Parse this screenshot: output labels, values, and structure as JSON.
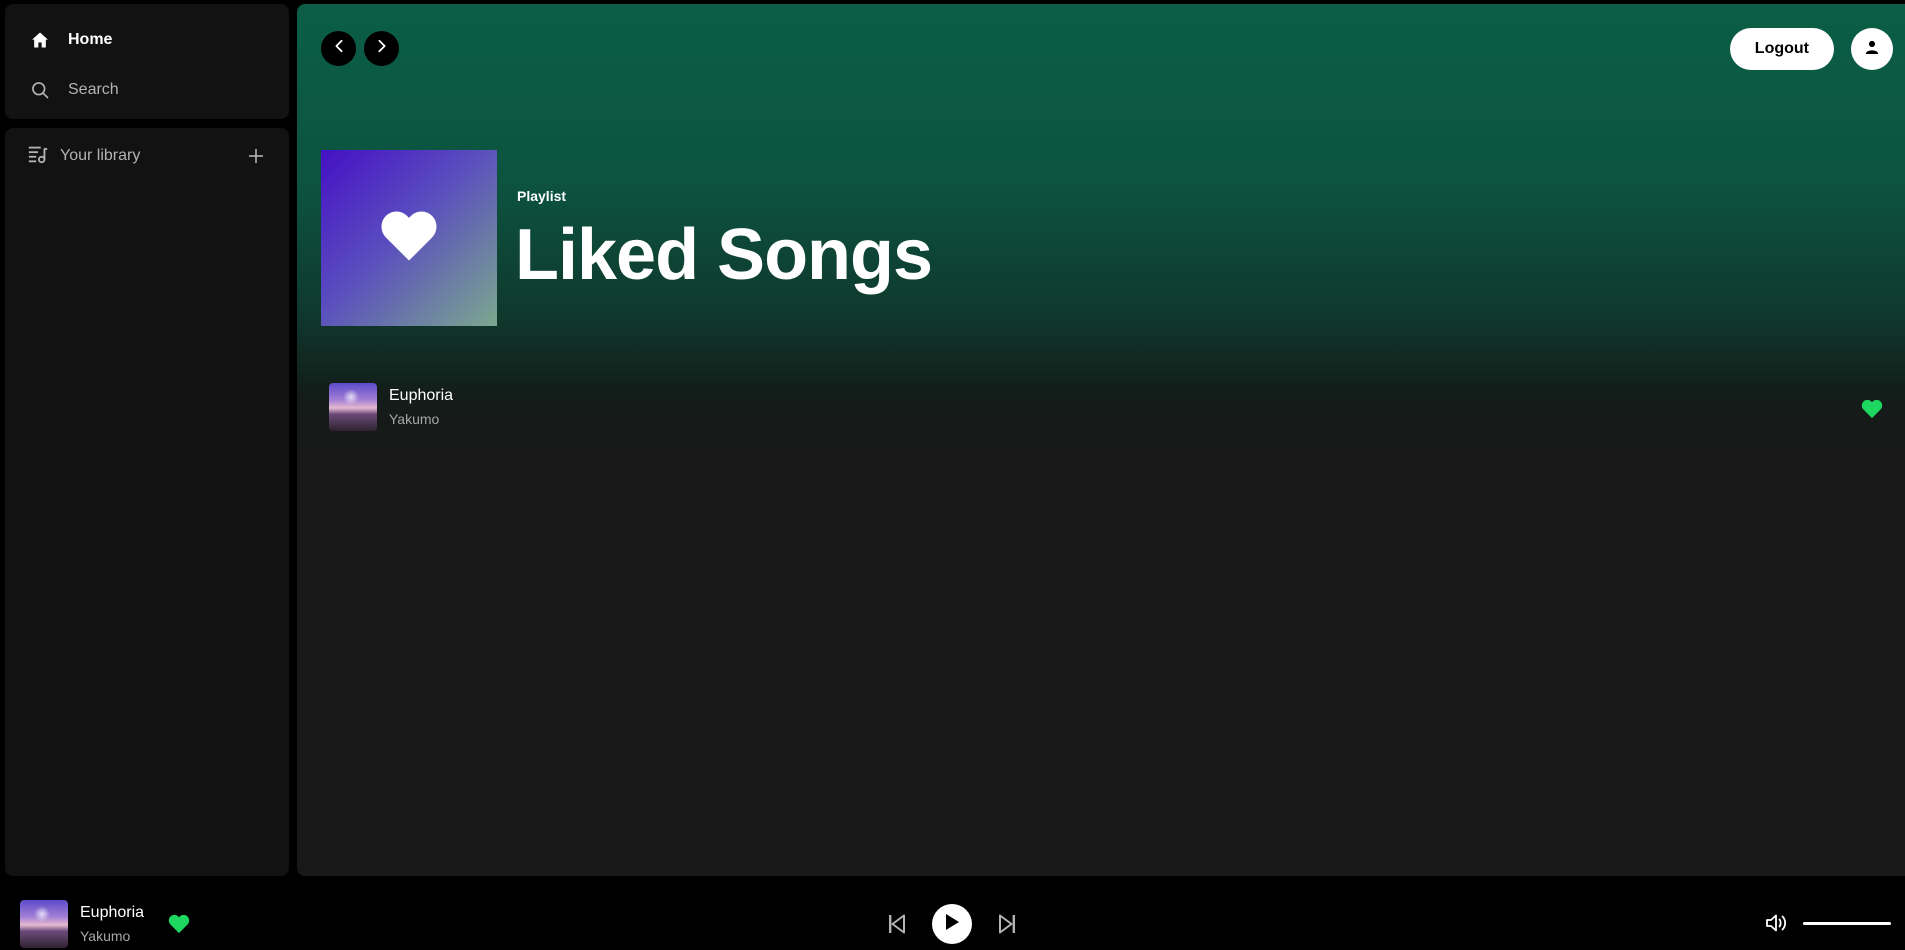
{
  "sidebar": {
    "nav": {
      "home_label": "Home",
      "search_label": "Search"
    },
    "library": {
      "label": "Your library"
    }
  },
  "header": {
    "logout_label": "Logout"
  },
  "playlist": {
    "type": "Playlist",
    "title": "Liked Songs",
    "tracks": [
      {
        "title": "Euphoria",
        "artist": "Yakumo",
        "liked": true
      }
    ]
  },
  "player": {
    "now_playing": {
      "title": "Euphoria",
      "artist": "Yakumo",
      "liked": true
    },
    "volume": 1.0
  },
  "colors": {
    "accent_green": "#1ed760",
    "header_gradient_top": "#0b5e45",
    "background": "#181818"
  },
  "icons": {
    "home": "home-icon",
    "search": "search-icon",
    "library": "library-icon",
    "add": "plus-icon",
    "back": "chevron-left-icon",
    "forward": "chevron-right-icon",
    "user": "user-icon",
    "heart": "heart-icon",
    "previous": "skip-previous-icon",
    "play": "play-icon",
    "next": "skip-next-icon",
    "volume": "volume-icon"
  }
}
